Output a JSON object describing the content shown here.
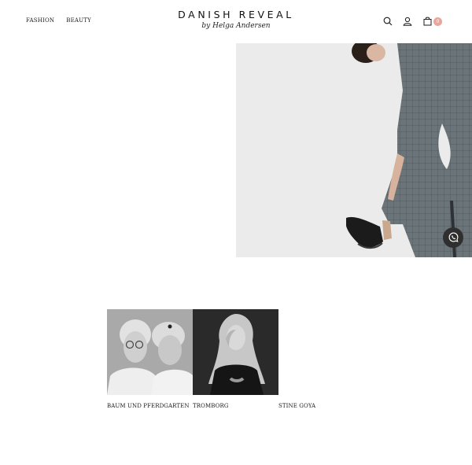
{
  "header": {
    "nav": [
      {
        "label": "FASHION"
      },
      {
        "label": "BEAUTY"
      }
    ],
    "brand_title": "DANISH REVEAL",
    "brand_subtitle": "by Helga Andersen",
    "cart_count": "0",
    "icons": [
      "search-icon",
      "user-icon",
      "cart-icon"
    ]
  },
  "colors": {
    "badge": "#e8a79d",
    "hero_background": "#ebebeb",
    "whatsapp_button": "#2f2f2f"
  },
  "designers": [
    {
      "name": "BAUM UND PFERDGARTEN"
    },
    {
      "name": "TROMBORG"
    },
    {
      "name": "STINE GOYA"
    }
  ]
}
